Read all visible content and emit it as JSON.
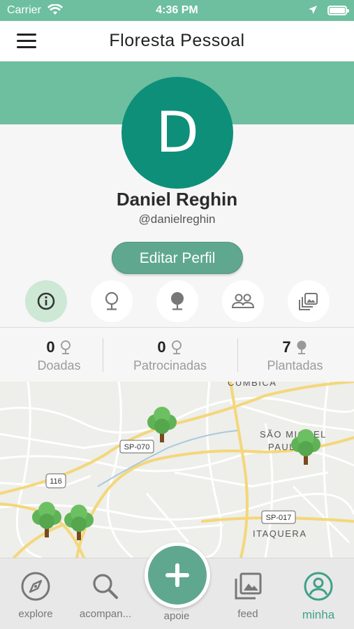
{
  "status_bar": {
    "carrier": "Carrier",
    "time": "4:36 PM"
  },
  "nav": {
    "title": "Floresta Pessoal"
  },
  "profile": {
    "initial": "D",
    "name": "Daniel Reghin",
    "handle": "@danielreghin",
    "edit_label": "Editar Perfil"
  },
  "tabs": [
    {
      "icon": "info-icon",
      "active": true
    },
    {
      "icon": "tree-outline-icon",
      "active": false
    },
    {
      "icon": "tree-filled-icon",
      "active": false
    },
    {
      "icon": "group-icon",
      "active": false
    },
    {
      "icon": "gallery-icon",
      "active": false
    }
  ],
  "stats": [
    {
      "value": "0",
      "label": "Doadas",
      "icon": "tree-outline-icon"
    },
    {
      "value": "0",
      "label": "Patrocinadas",
      "icon": "tree-outline-icon"
    },
    {
      "value": "7",
      "label": "Plantadas",
      "icon": "tree-filled-icon"
    }
  ],
  "map": {
    "labels": {
      "cumbica": "CUMBICA",
      "sao_miguel_1": "SÃO MIGUEL",
      "sao_miguel_2": "PAULISTA",
      "itaquera": "ITAQUERA"
    },
    "shields": {
      "sp070": "SP-070",
      "r116": "116",
      "sp017": "SP-017"
    },
    "markers": [
      "tree-marker",
      "tree-marker",
      "tree-marker",
      "tree-marker"
    ]
  },
  "bottom_nav": {
    "explore": "explore",
    "acompanhe": "acompan...",
    "apoie": "apoie",
    "feed": "feed",
    "minha": "minha"
  },
  "colors": {
    "brand_green": "#6dbf9f",
    "avatar_green": "#0e8f79",
    "button_green": "#5fa88f",
    "active_tab_bg": "#cde8d5",
    "active_nav_text": "#3fa187"
  }
}
